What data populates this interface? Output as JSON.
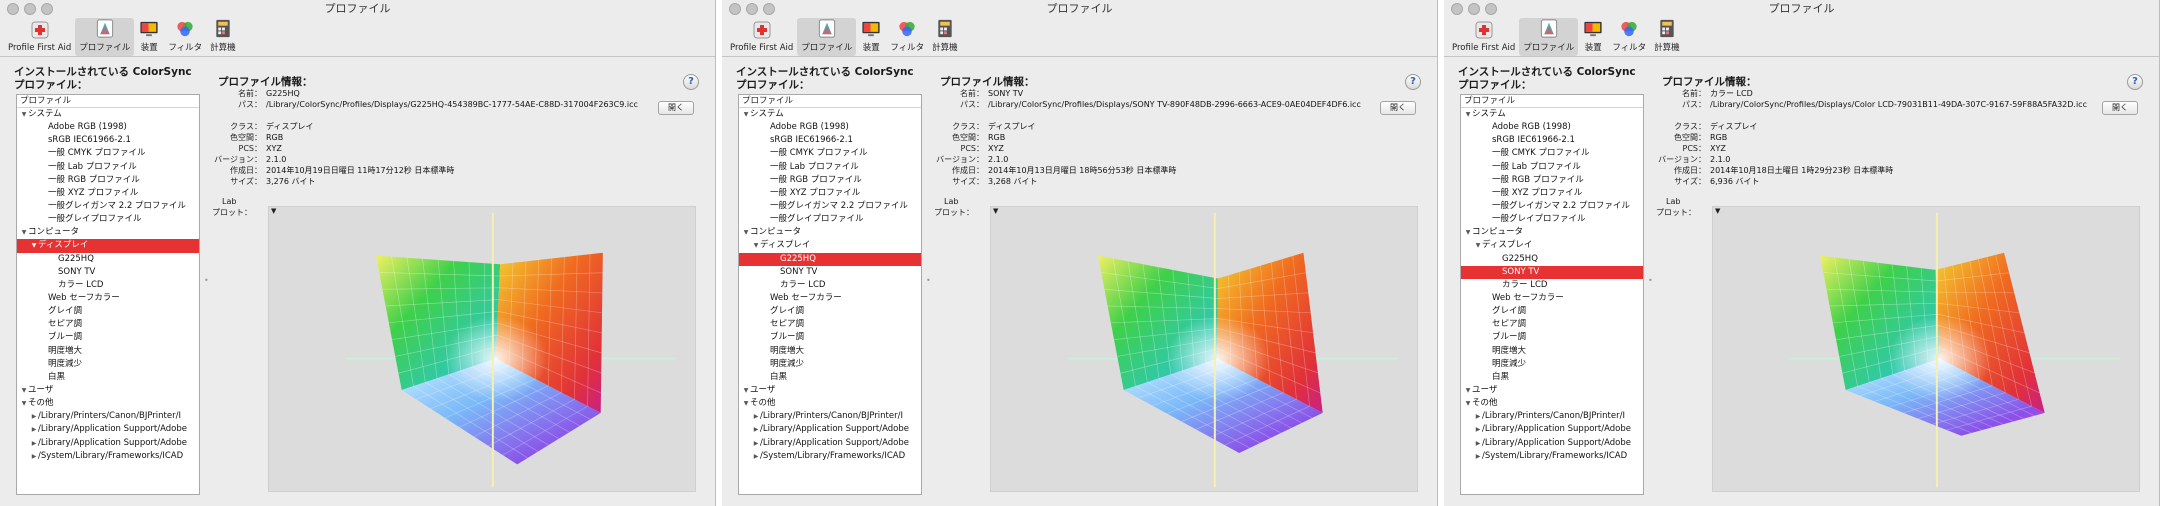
{
  "window": {
    "title": "プロファイル"
  },
  "toolbar": {
    "items": [
      {
        "label": "Profile First Aid",
        "icon": "profile-first-aid-icon"
      },
      {
        "label": "プロファイル",
        "icon": "profiles-icon"
      },
      {
        "label": "装置",
        "icon": "devices-icon"
      },
      {
        "label": "フィルタ",
        "icon": "filters-icon"
      },
      {
        "label": "計算機",
        "icon": "calculator-icon"
      }
    ],
    "active_index": 1
  },
  "sidebar": {
    "heading_line1": "インストールされている ColorSync",
    "heading_line2": "プロファイル：",
    "column_header": "プロファイル"
  },
  "info": {
    "heading": "プロファイル情報：",
    "help": "?",
    "open_button": "開く",
    "keys": {
      "name": "名前：",
      "path": "パス：",
      "class": "クラス：",
      "space": "色空間：",
      "pcs": "PCS：",
      "version": "バージョン：",
      "created": "作成日：",
      "size": "サイズ："
    },
    "lab_plot_label_1": "Lab",
    "lab_plot_label_2": "プロット："
  },
  "panels": [
    {
      "selected_row": 10,
      "profile": {
        "name": "G225HQ",
        "path": "/Library/ColorSync/Profiles/Displays/G225HQ-454389BC-1777-54AE-C88D-317004F263C9.icc",
        "class": "ディスプレイ",
        "space": "RGB",
        "pcs": "XYZ",
        "version": "2.1.0",
        "created": "2014年10月19日日曜日 11時17分12秒 日本標準時",
        "size": "3,276 バイト"
      },
      "gamut": {
        "top_x": 0.54,
        "top_y": 0.2,
        "right_x": 0.78,
        "bottom_y": 0.9
      }
    },
    {
      "selected_row": 11,
      "profile": {
        "name": "SONY TV",
        "path": "/Library/ColorSync/Profiles/Displays/SONY TV-890F48DB-2996-6663-ACE9-0AE04DEF4DF6.icc",
        "class": "ディスプレイ",
        "space": "RGB",
        "pcs": "XYZ",
        "version": "2.1.0",
        "created": "2014年10月13日月曜日 18時56分53秒 日本標準時",
        "size": "3,268 バイト"
      },
      "gamut": {
        "top_x": 0.53,
        "top_y": 0.25,
        "right_x": 0.73,
        "bottom_y": 0.86
      }
    },
    {
      "selected_row": 12,
      "profile": {
        "name": "カラー LCD",
        "path": "/Library/ColorSync/Profiles/Displays/Color LCD-79031B11-49DA-307C-9167-59F88A5FA32D.icc",
        "class": "ディスプレイ",
        "space": "RGB",
        "pcs": "XYZ",
        "version": "2.1.0",
        "created": "2014年10月18日土曜日 1時29分23秒 日本標準時",
        "size": "6,936 バイト"
      },
      "gamut": {
        "top_x": 0.52,
        "top_y": 0.22,
        "right_x": 0.68,
        "bottom_y": 0.8
      }
    }
  ],
  "tree": [
    {
      "label": "システム",
      "level": 0,
      "disclosure": "open"
    },
    {
      "label": "Adobe RGB (1998)",
      "level": 2,
      "disclosure": "none"
    },
    {
      "label": "sRGB IEC61966-2.1",
      "level": 2,
      "disclosure": "none"
    },
    {
      "label": "一般 CMYK プロファイル",
      "level": 2,
      "disclosure": "none"
    },
    {
      "label": "一般 Lab プロファイル",
      "level": 2,
      "disclosure": "none"
    },
    {
      "label": "一般 RGB プロファイル",
      "level": 2,
      "disclosure": "none"
    },
    {
      "label": "一般 XYZ プロファイル",
      "level": 2,
      "disclosure": "none"
    },
    {
      "label": "一般グレイガンマ 2.2 プロファイル",
      "level": 2,
      "disclosure": "none"
    },
    {
      "label": "一般グレイプロファイル",
      "level": 2,
      "disclosure": "none"
    },
    {
      "label": "コンピュータ",
      "level": 0,
      "disclosure": "open"
    },
    {
      "label": "ディスプレイ",
      "level": 1,
      "disclosure": "open"
    },
    {
      "label": "G225HQ",
      "level": 3,
      "disclosure": "none"
    },
    {
      "label": "SONY TV",
      "level": 3,
      "disclosure": "none"
    },
    {
      "label": "カラー LCD",
      "level": 3,
      "disclosure": "none"
    },
    {
      "label": "Web セーフカラー",
      "level": 2,
      "disclosure": "none"
    },
    {
      "label": "グレイ調",
      "level": 2,
      "disclosure": "none"
    },
    {
      "label": "セピア調",
      "level": 2,
      "disclosure": "none"
    },
    {
      "label": "ブルー調",
      "level": 2,
      "disclosure": "none"
    },
    {
      "label": "明度増大",
      "level": 2,
      "disclosure": "none"
    },
    {
      "label": "明度減少",
      "level": 2,
      "disclosure": "none"
    },
    {
      "label": "白黒",
      "level": 2,
      "disclosure": "none"
    },
    {
      "label": "ユーザ",
      "level": 0,
      "disclosure": "open"
    },
    {
      "label": "その他",
      "level": 0,
      "disclosure": "open"
    },
    {
      "label": "/Library/Printers/Canon/BJPrinter/I",
      "level": 1,
      "disclosure": "closed"
    },
    {
      "label": "/Library/Application Support/Adobe",
      "level": 1,
      "disclosure": "closed"
    },
    {
      "label": "/Library/Application Support/Adobe",
      "level": 1,
      "disclosure": "closed"
    },
    {
      "label": "/System/Library/Frameworks/ICAD",
      "level": 1,
      "disclosure": "closed"
    }
  ],
  "colors": {
    "selection": "#e63232",
    "window_bg": "#ececec",
    "plot_bg": "#dcdcdc",
    "axis_a": "#c9f0d8",
    "axis_b": "#f4f0b0"
  }
}
